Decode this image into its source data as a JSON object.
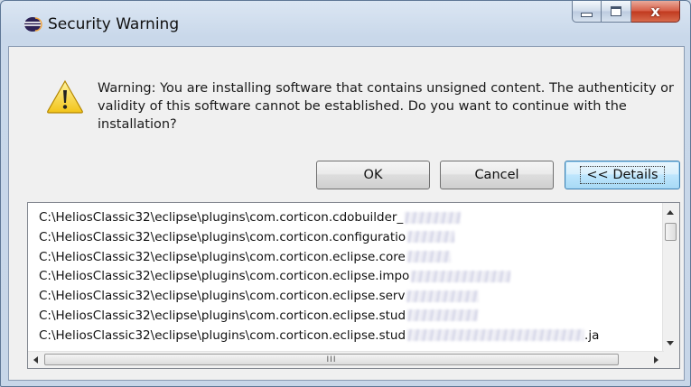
{
  "window": {
    "title": "Security Warning",
    "close_glyph": "x"
  },
  "dialog": {
    "message": "Warning: You are installing software that contains unsigned content. The authenticity or validity of this software cannot be established. Do you want to continue with the installation?",
    "icon": "warning-triangle-icon"
  },
  "buttons": {
    "ok": "OK",
    "cancel": "Cancel",
    "details": "<< Details"
  },
  "list": {
    "items": [
      "C:\\HeliosClassic32\\eclipse\\plugins\\com.corticon.cdobuilder_",
      "C:\\HeliosClassic32\\eclipse\\plugins\\com.corticon.configuratio",
      "C:\\HeliosClassic32\\eclipse\\plugins\\com.corticon.eclipse.core",
      "C:\\HeliosClassic32\\eclipse\\plugins\\com.corticon.eclipse.impo",
      "C:\\HeliosClassic32\\eclipse\\plugins\\com.corticon.eclipse.serv",
      "C:\\HeliosClassic32\\eclipse\\plugins\\com.corticon.eclipse.stud",
      "C:\\HeliosClassic32\\eclipse\\plugins\\com.corticon.eclipse.stud"
    ],
    "last_item_suffix": ".ja",
    "hscroll_grip": "III"
  },
  "colors": {
    "frame": "#c9d8ea",
    "client": "#f0f0f0",
    "close_button": "#c0391f",
    "default_button": "#bee6fd"
  }
}
